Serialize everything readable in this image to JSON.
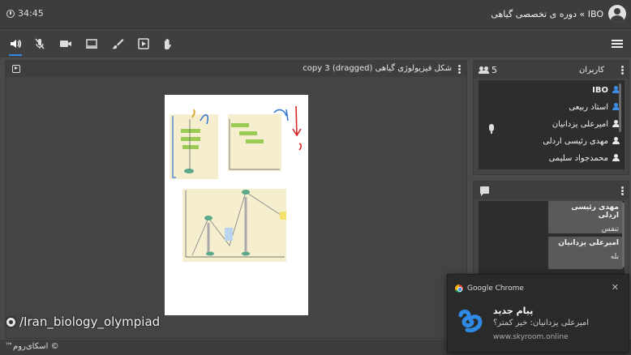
{
  "header": {
    "timer": "34:45",
    "room_title": "IBO » دوره ی تخصصی گیاهی"
  },
  "toolbar": {
    "tools": [
      "speaker-icon",
      "mic-muted-icon",
      "camera-icon",
      "screen-share-icon",
      "brush-icon",
      "presentation-icon",
      "raise-hand-icon"
    ],
    "active_tool": "speaker-icon"
  },
  "presentation": {
    "title": "شکل فیزیولوژی گیاهی copy 3 (dragged)"
  },
  "watermark": {
    "text": "/Iran_biology_olympiad"
  },
  "footer": {
    "copyright": "© اسکای‌روم™"
  },
  "users": {
    "label": "کاربران",
    "count": "5",
    "list": [
      {
        "name": "IBO",
        "role": "host"
      },
      {
        "name": "استاد ربیعی",
        "role": "presenter"
      },
      {
        "name": "امیرعلی یزدانیان",
        "role": "user"
      },
      {
        "name": "مهدی رئیسی اردلی",
        "role": "user"
      },
      {
        "name": "محمدجواد سلیمی",
        "role": "user"
      }
    ]
  },
  "chat": {
    "messages": [
      {
        "sender": "مهدی رئیسی اردلی",
        "text": "تنفس"
      },
      {
        "sender": "امیرعلی یزدانیان",
        "text": "بله"
      }
    ]
  },
  "notification": {
    "app": "Google Chrome",
    "title": "پیام جدید",
    "body": "امیرعلی یزدانیان: خیر کمتر؟",
    "url": "www.skyroom.online",
    "close": "✕"
  },
  "colors": {
    "accent": "#2f8ae6",
    "background": "#4a4a4a",
    "panel": "#2d2d2d"
  }
}
